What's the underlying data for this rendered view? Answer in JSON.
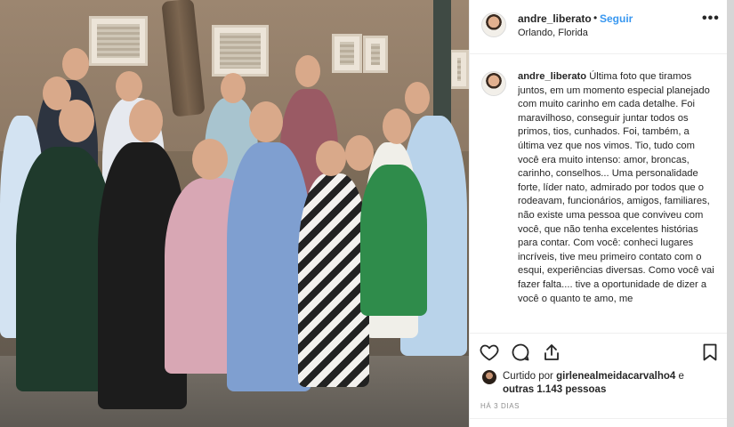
{
  "post": {
    "photo_alt": "Foto de família em frente a uma casa de pedra",
    "header": {
      "username": "andre_liberato",
      "separator": "•",
      "follow_label": "Seguir",
      "location": "Orlando, Florida",
      "more_icon": "more-horizontal-icon"
    },
    "caption": {
      "username": "andre_liberato",
      "text": "Última foto que tiramos juntos, em um momento especial planejado com muito carinho em cada detalhe. Foi maravilhoso, conseguir juntar todos os primos, tios, cunhados. Foi, também, a última vez que nos vimos. Tio, tudo com você era muito intenso: amor, broncas, carinho, conselhos... Uma personalidade forte, líder nato, admirado por todos que o rodeavam, funcionários, amigos, familiares, não existe uma pessoa que conviveu com você, que não tenha excelentes histórias para contar. Com você: conheci lugares incríveis, tive meu primeiro contato com o esqui, experiências diversas. Como você vai fazer falta.... tive a oportunidade de dizer a você o quanto te amo, me"
    },
    "actions": {
      "like_icon": "heart-icon",
      "comment_icon": "comment-icon",
      "share_icon": "share-icon",
      "save_icon": "bookmark-icon"
    },
    "likes": {
      "prefix": "Curtido por",
      "liker": "girlenealmeidacarvalho4",
      "conj": "e",
      "others": "outras 1.143 pessoas"
    },
    "timestamp": "HÁ 3 DIAS"
  },
  "colors": {
    "link_blue": "#3897f0",
    "text": "#262626",
    "muted": "#8e8e8e",
    "border": "#efefef"
  }
}
